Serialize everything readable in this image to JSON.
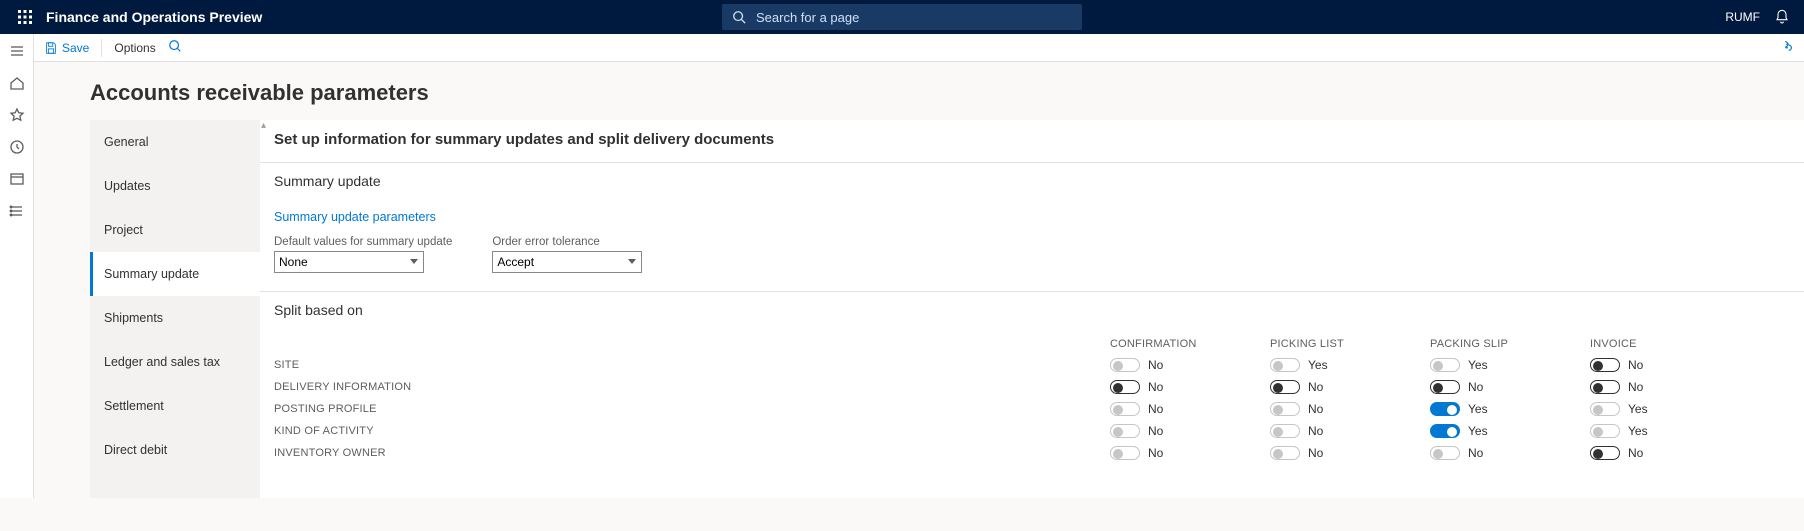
{
  "header": {
    "brand": "Finance and Operations Preview",
    "search_placeholder": "Search for a page",
    "user": "RUMF"
  },
  "actionbar": {
    "save_label": "Save",
    "options_label": "Options"
  },
  "page": {
    "title": "Accounts receivable parameters",
    "description": "Set up information for summary updates and split delivery documents"
  },
  "sidebar": {
    "items": [
      {
        "label": "General"
      },
      {
        "label": "Updates"
      },
      {
        "label": "Project"
      },
      {
        "label": "Summary update",
        "selected": true
      },
      {
        "label": "Shipments"
      },
      {
        "label": "Ledger and sales tax"
      },
      {
        "label": "Settlement"
      },
      {
        "label": "Direct debit"
      }
    ]
  },
  "sections": {
    "summary_update": {
      "title": "Summary update",
      "link_label": "Summary update parameters",
      "fields": {
        "default_values": {
          "label": "Default values for summary update",
          "value": "None"
        },
        "order_error": {
          "label": "Order error tolerance",
          "value": "Accept"
        }
      }
    },
    "split": {
      "title": "Split based on",
      "columns": [
        "CONFIRMATION",
        "PICKING LIST",
        "PACKING SLIP",
        "INVOICE"
      ],
      "rows": [
        {
          "label": "SITE",
          "cells": [
            {
              "on": false,
              "style": "plain",
              "text": "No"
            },
            {
              "on": false,
              "style": "plain",
              "text": "Yes"
            },
            {
              "on": false,
              "style": "plain",
              "text": "Yes"
            },
            {
              "on": false,
              "style": "outline",
              "text": "No"
            }
          ]
        },
        {
          "label": "DELIVERY INFORMATION",
          "cells": [
            {
              "on": false,
              "style": "outline",
              "text": "No"
            },
            {
              "on": false,
              "style": "outline",
              "text": "No"
            },
            {
              "on": false,
              "style": "outline",
              "text": "No"
            },
            {
              "on": false,
              "style": "outline",
              "text": "No"
            }
          ]
        },
        {
          "label": "POSTING PROFILE",
          "cells": [
            {
              "on": false,
              "style": "plain",
              "text": "No"
            },
            {
              "on": false,
              "style": "plain",
              "text": "No"
            },
            {
              "on": true,
              "style": "on",
              "text": "Yes"
            },
            {
              "on": false,
              "style": "plain",
              "text": "Yes"
            }
          ]
        },
        {
          "label": "KIND OF ACTIVITY",
          "cells": [
            {
              "on": false,
              "style": "plain",
              "text": "No"
            },
            {
              "on": false,
              "style": "plain",
              "text": "No"
            },
            {
              "on": true,
              "style": "on",
              "text": "Yes"
            },
            {
              "on": false,
              "style": "plain",
              "text": "Yes"
            }
          ]
        },
        {
          "label": "INVENTORY OWNER",
          "cells": [
            {
              "on": false,
              "style": "plain",
              "text": "No"
            },
            {
              "on": false,
              "style": "plain",
              "text": "No"
            },
            {
              "on": false,
              "style": "plain",
              "text": "No"
            },
            {
              "on": false,
              "style": "outline",
              "text": "No"
            }
          ]
        }
      ]
    }
  }
}
